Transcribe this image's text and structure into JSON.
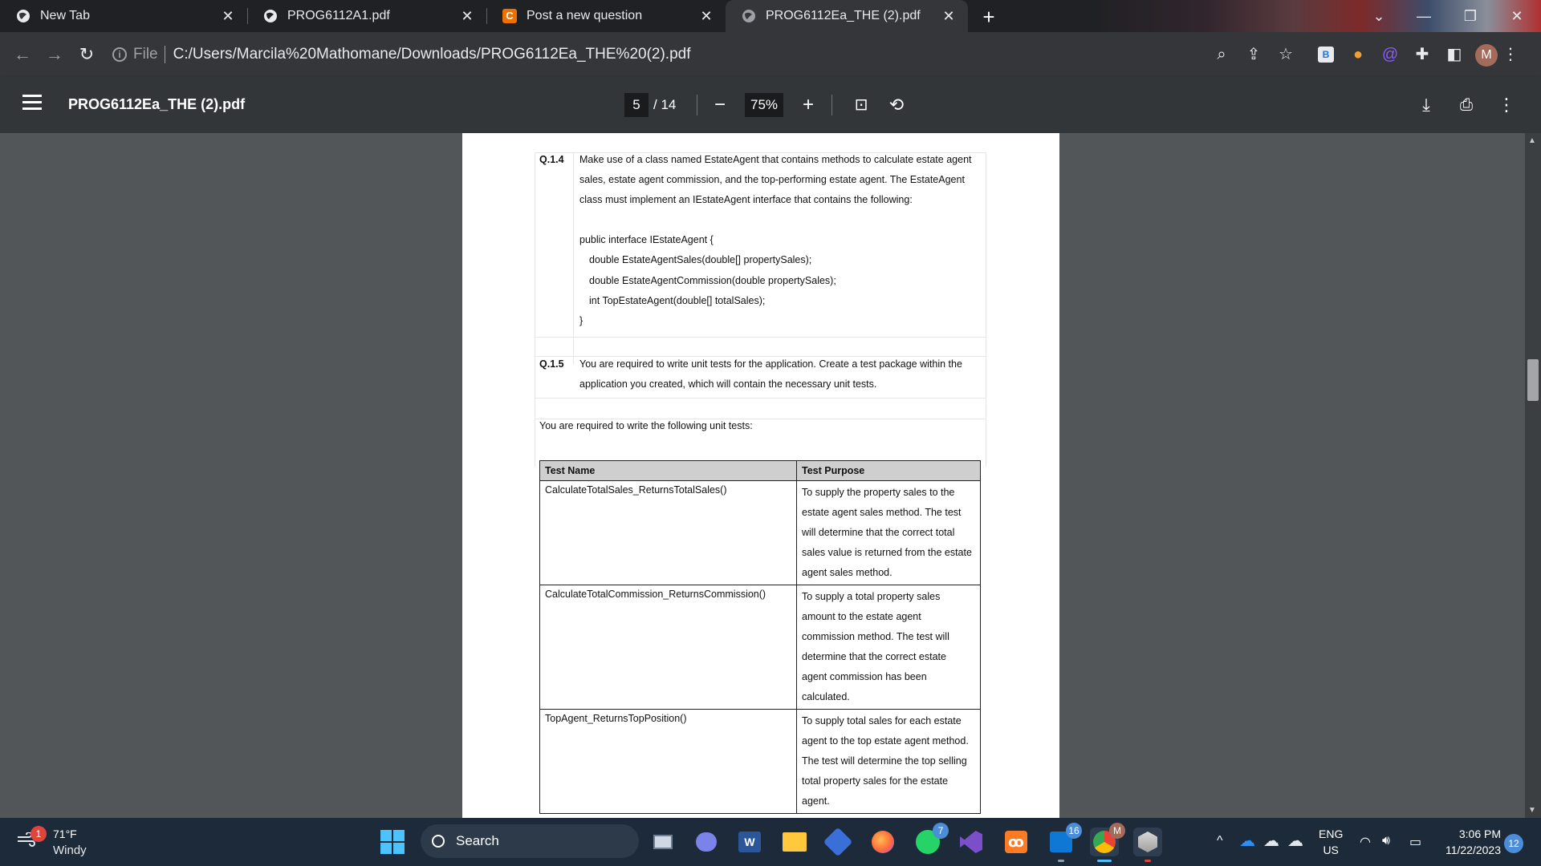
{
  "browser": {
    "tabs": [
      {
        "title": "New Tab",
        "icon": "globe-icon"
      },
      {
        "title": "PROG6112A1.pdf",
        "icon": "globe-icon"
      },
      {
        "title": "Post a new question",
        "icon": "chegg-icon"
      },
      {
        "title": "PROG6112Ea_THE (2).pdf",
        "icon": "globe-icon",
        "active": true
      }
    ],
    "address": {
      "scheme_label": "File",
      "url": "C:/Users/Marcila%20Mathomane/Downloads/PROG6112Ea_THE%20(2).pdf"
    },
    "profile_initial": "M"
  },
  "pdf": {
    "title": "PROG6112Ea_THE (2).pdf",
    "current_page": "5",
    "total_pages": "/ 14",
    "zoom": "75%"
  },
  "document": {
    "q14": {
      "number": "Q.1.4",
      "lines": [
        "Make use of a class named EstateAgent that contains methods to calculate estate agent",
        "sales, estate agent commission, and the top-performing estate agent. The EstateAgent",
        "class must implement an IEstateAgent interface that contains the following:"
      ],
      "code": [
        "public interface IEstateAgent {",
        "double EstateAgentSales(double[] propertySales);",
        "double EstateAgentCommission(double propertySales);",
        "int TopEstateAgent(double[] totalSales);",
        "}"
      ]
    },
    "q15": {
      "number": "Q.1.5",
      "lines": [
        "You are required to write unit tests for the application. Create a test package within the",
        "application you created, which will contain the necessary unit tests."
      ]
    },
    "intro": "You are required to write the following unit tests:",
    "table": {
      "headers": [
        "Test Name",
        "Test Purpose"
      ],
      "rows": [
        {
          "name": "CalculateTotalSales_ReturnsTotalSales()",
          "purpose": [
            "To supply the property sales to the",
            "estate agent sales method. The test",
            "will determine that the correct total",
            "sales value is returned from the estate",
            "agent sales method."
          ]
        },
        {
          "name": "CalculateTotalCommission_ReturnsCommission()",
          "purpose": [
            "To supply a total property sales",
            "amount to the estate agent",
            "commission method. The test will",
            "determine that the correct estate",
            "agent commission has been",
            "calculated."
          ]
        },
        {
          "name": "TopAgent_ReturnsTopPosition()",
          "purpose": [
            "To supply total sales for each estate",
            "agent to the top estate agent method.",
            "The test will determine the top selling",
            "total property sales for the estate",
            "agent."
          ]
        }
      ]
    }
  },
  "taskbar": {
    "weather": {
      "temp": "71°F",
      "condition": "Windy",
      "badge": "1"
    },
    "search_placeholder": "Search",
    "badges": {
      "whatsapp": "7",
      "outlook": "16",
      "chrome_profile": "M"
    },
    "lang_top": "ENG",
    "lang_bottom": "US",
    "time": "3:06 PM",
    "date": "11/22/2023",
    "notifications": "12"
  },
  "colors": {
    "accent": "#4cc2ff",
    "chegg": "#eb7100",
    "notif_badge": "#e0453d"
  }
}
